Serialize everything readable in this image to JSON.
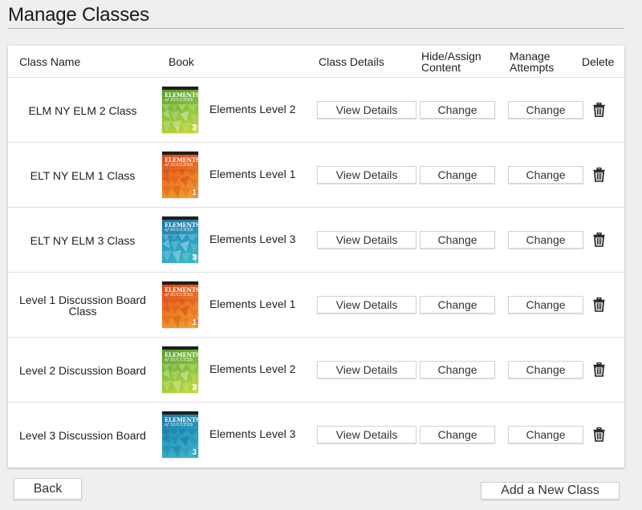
{
  "page": {
    "title": "Manage Classes"
  },
  "table": {
    "headers": {
      "class_name": "Class Name",
      "book": "Book",
      "class_details": "Class Details",
      "hide_assign_line1": "Hide/Assign",
      "hide_assign_line2": "Content",
      "manage_attempts_line1": "Manage",
      "manage_attempts_line2": "Attempts",
      "delete": "Delete"
    },
    "rows": [
      {
        "class_name": "ELM NY ELM 2 Class",
        "book": "Elements Level 2",
        "cover_level": "2",
        "cover_color": "green",
        "view_label": "View Details",
        "hide_label": "Change",
        "attempts_label": "Change"
      },
      {
        "class_name": "ELT NY ELM 1 Class",
        "book": "Elements Level 1",
        "cover_level": "1",
        "cover_color": "orange",
        "view_label": "View Details",
        "hide_label": "Change",
        "attempts_label": "Change"
      },
      {
        "class_name": "ELT NY ELM 3 Class",
        "book": "Elements Level 3",
        "cover_level": "3",
        "cover_color": "blue",
        "view_label": "View Details",
        "hide_label": "Change",
        "attempts_label": "Change"
      },
      {
        "class_name": "Level 1 Discussion Board Class",
        "book": "Elements Level 1",
        "cover_level": "1",
        "cover_color": "orange",
        "view_label": "View Details",
        "hide_label": "Change",
        "attempts_label": "Change"
      },
      {
        "class_name": "Level 2 Discussion Board",
        "book": "Elements Level 2",
        "cover_level": "2",
        "cover_color": "green",
        "view_label": "View Details",
        "hide_label": "Change",
        "attempts_label": "Change"
      },
      {
        "class_name": "Level 3 Discussion Board",
        "book": "Elements Level 3",
        "cover_level": "3",
        "cover_color": "blue",
        "view_label": "View Details",
        "hide_label": "Change",
        "attempts_label": "Change"
      }
    ]
  },
  "cover": {
    "title_line1": "ELEMENTS",
    "title_line2": "of SUCCESS"
  },
  "cover_colors": {
    "green": [
      "#4d9a2a",
      "#8cc43c",
      "#c9d83a",
      "#2f7d2a"
    ],
    "orange": [
      "#d2401c",
      "#ee7a24",
      "#f2a531",
      "#b8321a"
    ],
    "blue": [
      "#1b6f9a",
      "#2a9fc4",
      "#3fb8c8",
      "#155a84"
    ]
  },
  "footer": {
    "back_label": "Back",
    "add_label": "Add a New Class"
  },
  "icons": {
    "delete": "trash-icon"
  }
}
